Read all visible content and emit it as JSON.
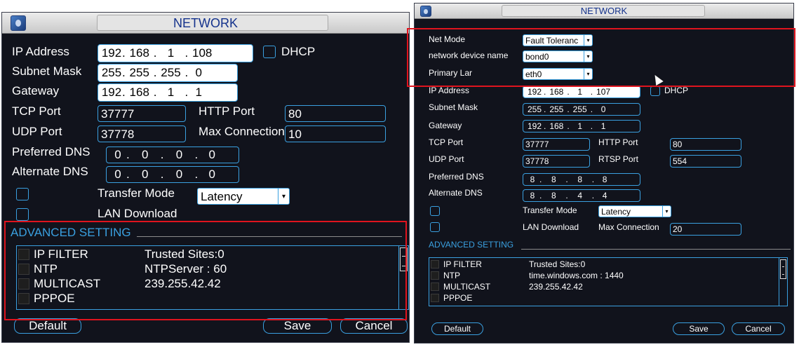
{
  "left": {
    "title": "NETWORK",
    "ip_label": "IP Address",
    "ip": [
      "192",
      "168",
      "1",
      "108"
    ],
    "dhcp_label": "DHCP",
    "subnet_label": "Subnet Mask",
    "subnet": [
      "255",
      "255",
      "255",
      "0"
    ],
    "gateway_label": "Gateway",
    "gateway": [
      "192",
      "168",
      "1",
      "1"
    ],
    "tcp_label": "TCP Port",
    "tcp_value": "37777",
    "http_label": "HTTP Port",
    "http_value": "80",
    "udp_label": "UDP Port",
    "udp_value": "37778",
    "maxconn_label": "Max Connection",
    "maxconn_value": "10",
    "pdns_label": "Preferred DNS",
    "pdns": [
      "0",
      "0",
      "0",
      "0"
    ],
    "adns_label": "Alternate DNS",
    "adns": [
      "0",
      "0",
      "0",
      "0"
    ],
    "transfer_label": "Transfer Mode",
    "transfer_value": "Latency",
    "lan_label": "LAN Download",
    "advanced_label": "ADVANCED SETTING",
    "advanced_rows": [
      {
        "name": "IP FILTER",
        "value": "Trusted Sites:0"
      },
      {
        "name": "NTP",
        "value": "NTPServer : 60"
      },
      {
        "name": "MULTICAST",
        "value": "239.255.42.42"
      },
      {
        "name": "PPPOE",
        "value": ""
      }
    ],
    "default_label": "Default",
    "save_label": "Save",
    "cancel_label": "Cancel"
  },
  "right": {
    "title": "NETWORK",
    "netmode_label": "Net Mode",
    "netmode_value": "Fault Toleranc",
    "devname_label": "network device name",
    "devname_value": "bond0",
    "primary_label": "Primary Lar",
    "primary_value": "eth0",
    "ip_label": "IP Address",
    "ip": [
      "192",
      "168",
      "1",
      "107"
    ],
    "dhcp_label": "DHCP",
    "subnet_label": "Subnet Mask",
    "subnet": [
      "255",
      "255",
      "255",
      "0"
    ],
    "gateway_label": "Gateway",
    "gateway": [
      "192",
      "168",
      "1",
      "1"
    ],
    "tcp_label": "TCP Port",
    "tcp_value": "37777",
    "http_label": "HTTP Port",
    "http_value": "80",
    "udp_label": "UDP Port",
    "udp_value": "37778",
    "rtsp_label": "RTSP Port",
    "rtsp_value": "554",
    "pdns_label": "Preferred DNS",
    "pdns": [
      "8",
      "8",
      "8",
      "8"
    ],
    "adns_label": "Alternate DNS",
    "adns": [
      "8",
      "8",
      "4",
      "4"
    ],
    "transfer_label": "Transfer Mode",
    "transfer_value": "Latency",
    "lan_label": "LAN Download",
    "maxconn_label": "Max Connection",
    "maxconn_value": "20",
    "advanced_label": "ADVANCED SETTING",
    "advanced_rows": [
      {
        "name": "IP FILTER",
        "value": "Trusted Sites:0"
      },
      {
        "name": "NTP",
        "value": "time.windows.com : 1440"
      },
      {
        "name": "MULTICAST",
        "value": "239.255.42.42"
      },
      {
        "name": "PPPOE",
        "value": ""
      }
    ],
    "default_label": "Default",
    "save_label": "Save",
    "cancel_label": "Cancel"
  },
  "colors": {
    "accent": "#3aa0e0",
    "panel_bg": "#11131c",
    "title_text": "#14328c",
    "highlight": "#e0141e"
  }
}
